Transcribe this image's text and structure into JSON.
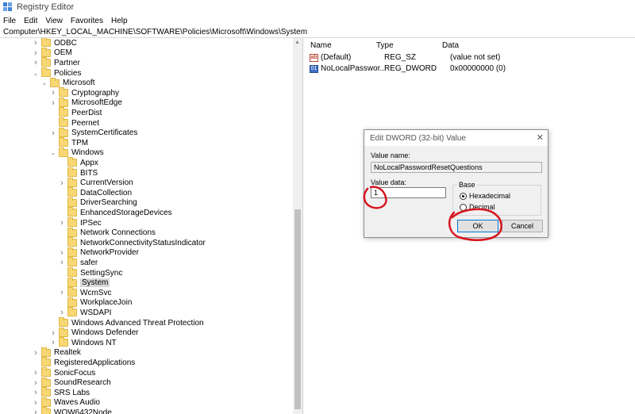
{
  "window": {
    "title": "Registry Editor"
  },
  "menu": [
    "File",
    "Edit",
    "View",
    "Favorites",
    "Help"
  ],
  "address": "Computer\\HKEY_LOCAL_MACHINE\\SOFTWARE\\Policies\\Microsoft\\Windows\\System",
  "tree": [
    {
      "label": "ODBC",
      "depth": 0,
      "exp": "c"
    },
    {
      "label": "OEM",
      "depth": 0,
      "exp": "c"
    },
    {
      "label": "Partner",
      "depth": 0,
      "exp": "c"
    },
    {
      "label": "Policies",
      "depth": 0,
      "exp": "o"
    },
    {
      "label": "Microsoft",
      "depth": 1,
      "exp": "o"
    },
    {
      "label": "Cryptography",
      "depth": 2,
      "exp": "c"
    },
    {
      "label": "MicrosoftEdge",
      "depth": 2,
      "exp": "c"
    },
    {
      "label": "PeerDist",
      "depth": 2,
      "exp": ""
    },
    {
      "label": "Peernet",
      "depth": 2,
      "exp": ""
    },
    {
      "label": "SystemCertificates",
      "depth": 2,
      "exp": "c"
    },
    {
      "label": "TPM",
      "depth": 2,
      "exp": ""
    },
    {
      "label": "Windows",
      "depth": 2,
      "exp": "o"
    },
    {
      "label": "Appx",
      "depth": 3,
      "exp": ""
    },
    {
      "label": "BITS",
      "depth": 3,
      "exp": ""
    },
    {
      "label": "CurrentVersion",
      "depth": 3,
      "exp": "c"
    },
    {
      "label": "DataCollection",
      "depth": 3,
      "exp": ""
    },
    {
      "label": "DriverSearching",
      "depth": 3,
      "exp": ""
    },
    {
      "label": "EnhancedStorageDevices",
      "depth": 3,
      "exp": ""
    },
    {
      "label": "IPSec",
      "depth": 3,
      "exp": "c"
    },
    {
      "label": "Network Connections",
      "depth": 3,
      "exp": ""
    },
    {
      "label": "NetworkConnectivityStatusIndicator",
      "depth": 3,
      "exp": ""
    },
    {
      "label": "NetworkProvider",
      "depth": 3,
      "exp": "c"
    },
    {
      "label": "safer",
      "depth": 3,
      "exp": "c"
    },
    {
      "label": "SettingSync",
      "depth": 3,
      "exp": ""
    },
    {
      "label": "System",
      "depth": 3,
      "exp": "",
      "selected": true
    },
    {
      "label": "WcmSvc",
      "depth": 3,
      "exp": "c"
    },
    {
      "label": "WorkplaceJoin",
      "depth": 3,
      "exp": ""
    },
    {
      "label": "WSDAPI",
      "depth": 3,
      "exp": "c"
    },
    {
      "label": "Windows Advanced Threat Protection",
      "depth": 2,
      "exp": ""
    },
    {
      "label": "Windows Defender",
      "depth": 2,
      "exp": "c"
    },
    {
      "label": "Windows NT",
      "depth": 2,
      "exp": "c"
    },
    {
      "label": "Realtek",
      "depth": 0,
      "exp": "c"
    },
    {
      "label": "RegisteredApplications",
      "depth": 0,
      "exp": ""
    },
    {
      "label": "SonicFocus",
      "depth": 0,
      "exp": "c"
    },
    {
      "label": "SoundResearch",
      "depth": 0,
      "exp": "c"
    },
    {
      "label": "SRS Labs",
      "depth": 0,
      "exp": "c"
    },
    {
      "label": "Waves Audio",
      "depth": 0,
      "exp": "c"
    },
    {
      "label": "WOW6432Node",
      "depth": 0,
      "exp": "c"
    }
  ],
  "values_pane": {
    "headers": {
      "name": "Name",
      "type": "Type",
      "data": "Data"
    },
    "rows": [
      {
        "icon": "string-value-icon",
        "glyph": "ab",
        "name": "(Default)",
        "type": "REG_SZ",
        "data": "(value not set)"
      },
      {
        "icon": "dword-value-icon",
        "glyph": "01",
        "name": "NoLocalPasswor...",
        "type": "REG_DWORD",
        "data": "0x00000000 (0)"
      }
    ]
  },
  "dialog": {
    "title": "Edit DWORD (32-bit) Value",
    "value_name_label": "Value name:",
    "value_name": "NoLocalPasswordResetQuestions",
    "value_data_label": "Value data:",
    "value_data": "1",
    "base_label": "Base",
    "base_options": [
      {
        "label": "Hexadecimal",
        "selected": true
      },
      {
        "label": "Decimal",
        "selected": false
      }
    ],
    "ok_label": "OK",
    "cancel_label": "Cancel"
  },
  "annotation_color": "#d7141e",
  "accent_color": "#0078d7"
}
